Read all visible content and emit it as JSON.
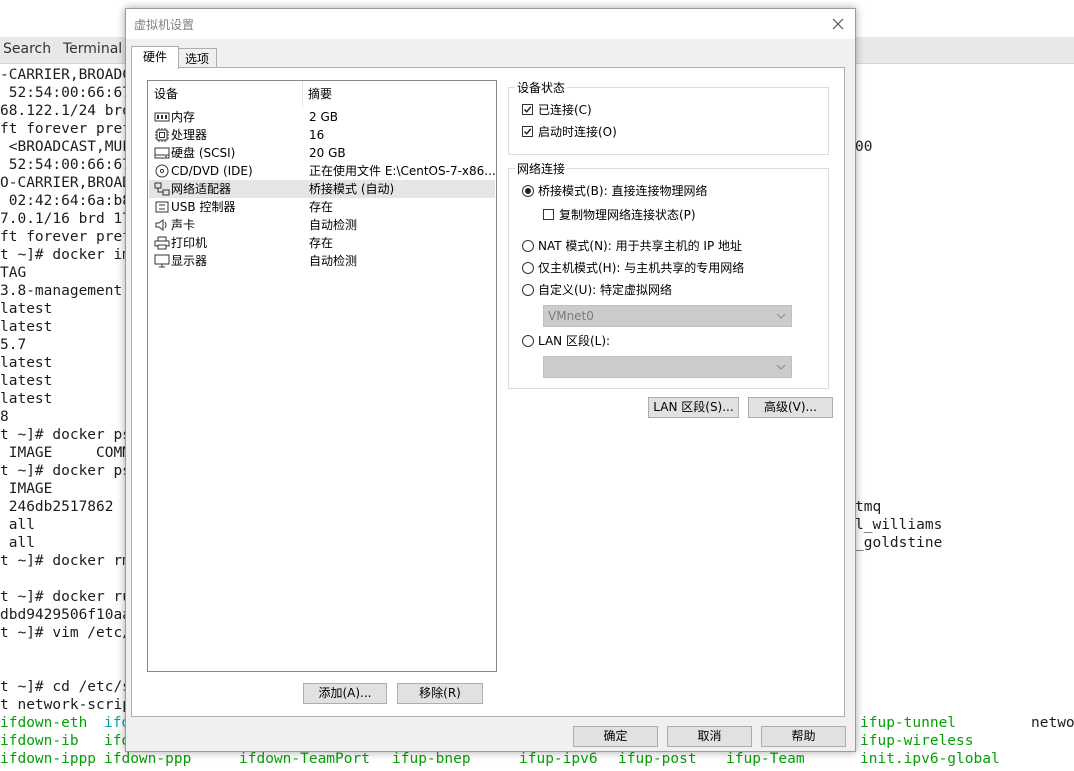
{
  "terminal": {
    "menu": [
      "Search",
      "Terminal"
    ],
    "lines": [
      {
        "text": "-CARRIER,BROADC",
        "color": "dark"
      },
      {
        "text": " 52:54:00:66:67",
        "color": "dark"
      },
      {
        "text": "68.122.1/24 brd",
        "color": "dark"
      },
      {
        "text": "ft forever pref",
        "color": "dark"
      },
      {
        "text": " <BROADCAST,MUL",
        "color": "dark"
      },
      {
        "text": " 52:54:00:66:67",
        "color": "dark"
      },
      {
        "text": "O-CARRIER,BROAD",
        "color": "dark"
      },
      {
        "text": " 02:42:64:6a:b8",
        "color": "dark"
      },
      {
        "text": "7.0.1/16 brd 17",
        "color": "dark"
      },
      {
        "text": "ft forever pref",
        "color": "dark"
      },
      {
        "text": "t ~]# docker im",
        "color": "dark"
      },
      {
        "text": "TAG",
        "color": "dark"
      },
      {
        "text": "3.8-management",
        "color": "dark"
      },
      {
        "text": "latest",
        "color": "dark"
      },
      {
        "text": "latest",
        "color": "dark"
      },
      {
        "text": "5.7",
        "color": "dark"
      },
      {
        "text": "latest",
        "color": "dark"
      },
      {
        "text": "latest",
        "color": "dark"
      },
      {
        "text": "latest",
        "color": "dark"
      },
      {
        "text": "8",
        "color": "dark"
      },
      {
        "text": "t ~]# docker ps",
        "color": "dark"
      },
      {
        "text": " IMAGE     COMM",
        "color": "dark"
      },
      {
        "text": "t ~]# docker ps",
        "color": "dark"
      },
      {
        "text": " IMAGE",
        "color": "dark"
      },
      {
        "text": " 246db2517862",
        "color": "dark"
      },
      {
        "text": " all",
        "color": "dark"
      },
      {
        "text": " all",
        "color": "dark"
      },
      {
        "text": "t ~]# docker rm",
        "color": "dark"
      },
      {
        "text": "",
        "color": "dark"
      },
      {
        "text": "t ~]# docker ru",
        "color": "dark"
      },
      {
        "text": "dbd9429506f10aa",
        "color": "dark"
      },
      {
        "text": "t ~]# vim /etc/",
        "color": "dark"
      },
      {
        "text": "",
        "color": "dark"
      },
      {
        "text": "",
        "color": "dark"
      },
      {
        "text": "t ~]# cd /etc/s",
        "color": "dark"
      },
      {
        "text": "t network-scrip",
        "color": "dark"
      }
    ],
    "bottom_lines": [
      [
        {
          "text": "ifdown-eth",
          "color": "green"
        },
        {
          "text": "ifd",
          "color": "cyan"
        }
      ],
      [
        {
          "text": "ifdown-ib",
          "color": "green"
        },
        {
          "text": "ifd",
          "color": "green"
        }
      ],
      [
        {
          "text": "ifdown-ippp",
          "color": "green"
        },
        {
          "text": "ifdown-ppp",
          "color": "green"
        },
        {
          "text": "ifdown-TeamPort",
          "color": "green"
        },
        {
          "text": "ifup-bnep",
          "color": "green"
        },
        {
          "text": "ifup-ipv6",
          "color": "green"
        },
        {
          "text": "ifup-post",
          "color": "green"
        },
        {
          "text": "ifup-Team",
          "color": "green"
        }
      ]
    ],
    "right_fragments": [
      {
        "text": "00"
      },
      {
        "text": "tmq"
      },
      {
        "text": "l_williams"
      },
      {
        "text": "_goldstine"
      }
    ],
    "right_bottom": [
      [
        {
          "text": "ifup-tunnel",
          "color": "green"
        },
        {
          "text": "netwo",
          "color": "dark"
        }
      ],
      [
        {
          "text": "ifup-wireless",
          "color": "green"
        }
      ],
      [
        {
          "text": "init.ipv6-global",
          "color": "green"
        }
      ]
    ]
  },
  "dialog": {
    "title": "虚拟机设置",
    "tabs": [
      "硬件",
      "选项"
    ],
    "device_list": {
      "headers": [
        "设备",
        "摘要"
      ],
      "rows": [
        {
          "icon": "memory-icon",
          "name": "内存",
          "summary": "2 GB"
        },
        {
          "icon": "processor-icon",
          "name": "处理器",
          "summary": "16"
        },
        {
          "icon": "hard-disk-icon",
          "name": "硬盘 (SCSI)",
          "summary": "20 GB"
        },
        {
          "icon": "cd-dvd-icon",
          "name": "CD/DVD (IDE)",
          "summary": "正在使用文件 E:\\CentOS-7-x86..."
        },
        {
          "icon": "network-adapter-icon",
          "name": "网络适配器",
          "summary": "桥接模式 (自动)"
        },
        {
          "icon": "usb-icon",
          "name": "USB 控制器",
          "summary": "存在"
        },
        {
          "icon": "sound-card-icon",
          "name": "声卡",
          "summary": "自动检测"
        },
        {
          "icon": "printer-icon",
          "name": "打印机",
          "summary": "存在"
        },
        {
          "icon": "display-icon",
          "name": "显示器",
          "summary": "自动检测"
        }
      ],
      "selected_index": 4
    },
    "add_button": "添加(A)...",
    "remove_button": "移除(R)",
    "device_status": {
      "legend": "设备状态",
      "connected": {
        "label": "已连接(C)",
        "checked": true
      },
      "connect_at_power_on": {
        "label": "启动时连接(O)",
        "checked": true
      }
    },
    "network_connection": {
      "legend": "网络连接",
      "bridged": {
        "label": "桥接模式(B): 直接连接物理网络",
        "selected": true
      },
      "replicate": {
        "label": "复制物理网络连接状态(P)",
        "checked": false
      },
      "nat": {
        "label": "NAT 模式(N): 用于共享主机的 IP 地址",
        "selected": false
      },
      "host_only": {
        "label": "仅主机模式(H): 与主机共享的专用网络",
        "selected": false
      },
      "custom": {
        "label": "自定义(U): 特定虚拟网络",
        "selected": false
      },
      "custom_select_value": "VMnet0",
      "lan_segment": {
        "label": "LAN 区段(L):",
        "selected": false
      },
      "lan_select_value": ""
    },
    "lan_segments_button": "LAN 区段(S)...",
    "advanced_button": "高级(V)...",
    "ok_button": "确定",
    "cancel_button": "取消",
    "help_button": "帮助"
  }
}
